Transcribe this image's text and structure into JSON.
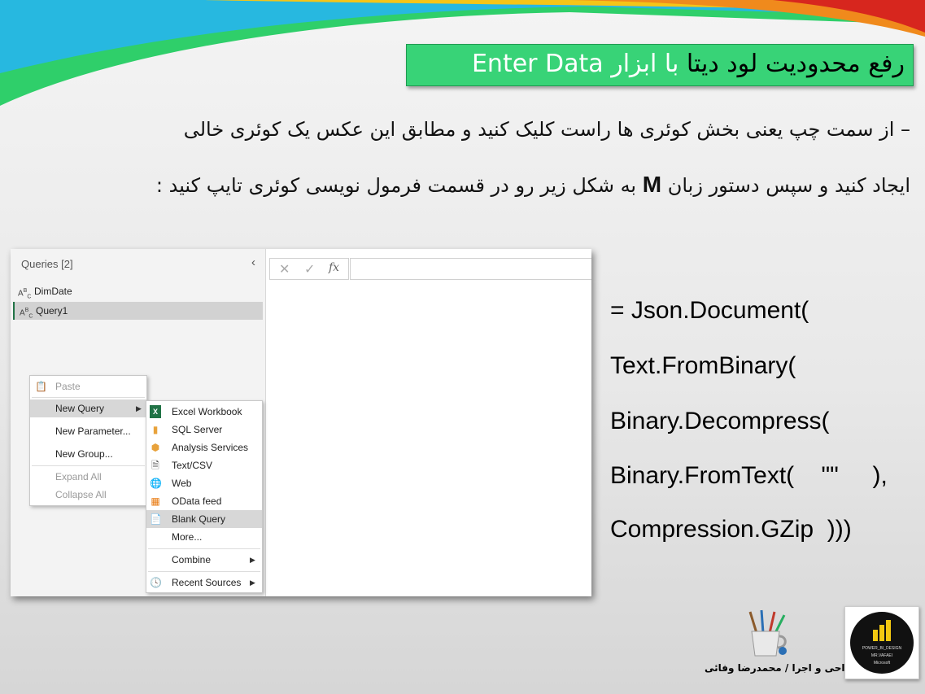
{
  "title": {
    "rtl_part_1": "رفع محدودیت لود دیتا",
    "rtl_part_2": "با ابزار",
    "tool_name": "Enter Data"
  },
  "paragraph": {
    "line1": "– از سمت چپ یعنی بخش کوئری ها راست کلیک کنید و مطابق این عکس یک کوئری خالی",
    "line2_a": "ایجاد کنید و سپس دستور زبان",
    "line2_m": "M",
    "line2_b": "به شکل زیر رو در قسمت فرمول نویسی کوئری تایپ کنید :"
  },
  "power_query": {
    "queries_header": "Queries [2]",
    "collapse_glyph": "‹",
    "query_type_icon": "abc-text-icon",
    "queries": [
      {
        "name": "DimDate",
        "selected": false
      },
      {
        "name": "Query1",
        "selected": true
      }
    ],
    "formula_bar": {
      "cancel": "✕",
      "confirm": "✓",
      "fx": "fx"
    },
    "context_menu": [
      "Paste",
      "New Query",
      "New Parameter...",
      "New Group...",
      "Expand All",
      "Collapse All"
    ],
    "submenu": [
      "Excel Workbook",
      "SQL Server",
      "Analysis Services",
      "Text/CSV",
      "Web",
      "OData feed",
      "Blank Query",
      "More...",
      "Combine",
      "Recent Sources"
    ],
    "arrow_glyph": "▶"
  },
  "code": [
    "= Json.Document(",
    "Text.FromBinary(",
    "Binary.Decompress(",
    "Binary.FromText(    \"\"     ),",
    "Compression.GZip  )))"
  ],
  "logo_text": {
    "line1": "POWER_BI_DESIGN",
    "line2": "MR.VAFAEI",
    "line3": "Microsoft"
  },
  "credit": "طراحی و اجرا / محمدرضا وفائی",
  "colors": {
    "title_bg": "#38d377",
    "excel_green": "#217346",
    "selection_gray": "#d2d2d2"
  }
}
